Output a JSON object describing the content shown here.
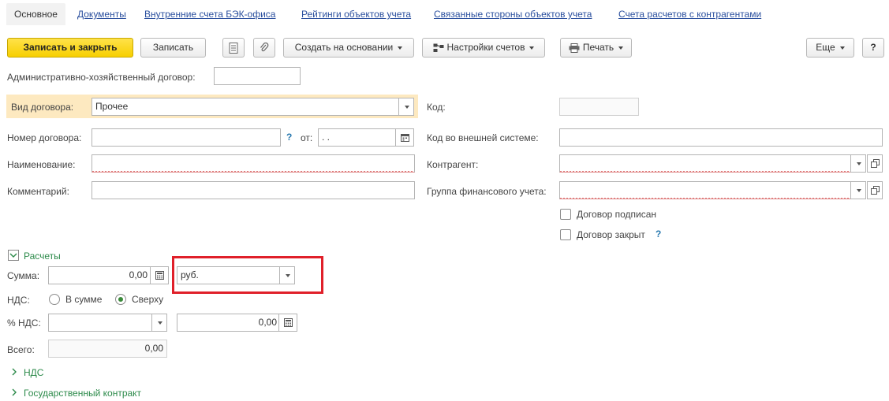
{
  "tabs": [
    {
      "label": "Основное"
    },
    {
      "label": "Документы"
    },
    {
      "label": "Внутренние счета БЭК-офиса"
    },
    {
      "label": "Рейтинги объектов учета"
    },
    {
      "label": "Связанные стороны объектов учета"
    },
    {
      "label": "Счета расчетов с контрагентами"
    }
  ],
  "toolbar": {
    "save_close": "Записать и закрыть",
    "save": "Записать",
    "create_based": "Создать на основании",
    "account_settings": "Настройки счетов",
    "print": "Печать",
    "more": "Еще",
    "help": "?"
  },
  "form": {
    "admin_contract_label": "Административно-хозяйственный договор:",
    "contract_type_label": "Вид договора:",
    "contract_type_value": "Прочее",
    "code_label": "Код:",
    "contract_number_label": "Номер договора:",
    "help_mark": "?",
    "date_from_label": "от:",
    "date_value": " .  .",
    "external_code_label": "Код во внешней системе:",
    "name_label": "Наименование:",
    "counterparty_label": "Контрагент:",
    "comment_label": "Комментарий:",
    "fin_group_label": "Группа финансового учета:",
    "signed_label": "Договор подписан",
    "closed_label": "Договор закрыт"
  },
  "payments": {
    "section_title": "Расчеты",
    "sum_label": "Сумма:",
    "sum_value": "0,00",
    "currency_value": "руб.",
    "vat_label": "НДС:",
    "vat_option_in_sum": "В сумме",
    "vat_option_on_top": "Сверху",
    "vat_percent_label": "% НДС:",
    "vat_amount_value": "0,00",
    "total_label": "Всего:",
    "total_value": "0,00"
  },
  "sections": {
    "vat": "НДС",
    "gov_contract": "Государственный контракт"
  },
  "colors": {
    "accent_yellow": "#f7cf00",
    "highlight_red": "#e0202a",
    "link_blue": "#2a4f9e",
    "section_green": "#2c8a4a"
  }
}
